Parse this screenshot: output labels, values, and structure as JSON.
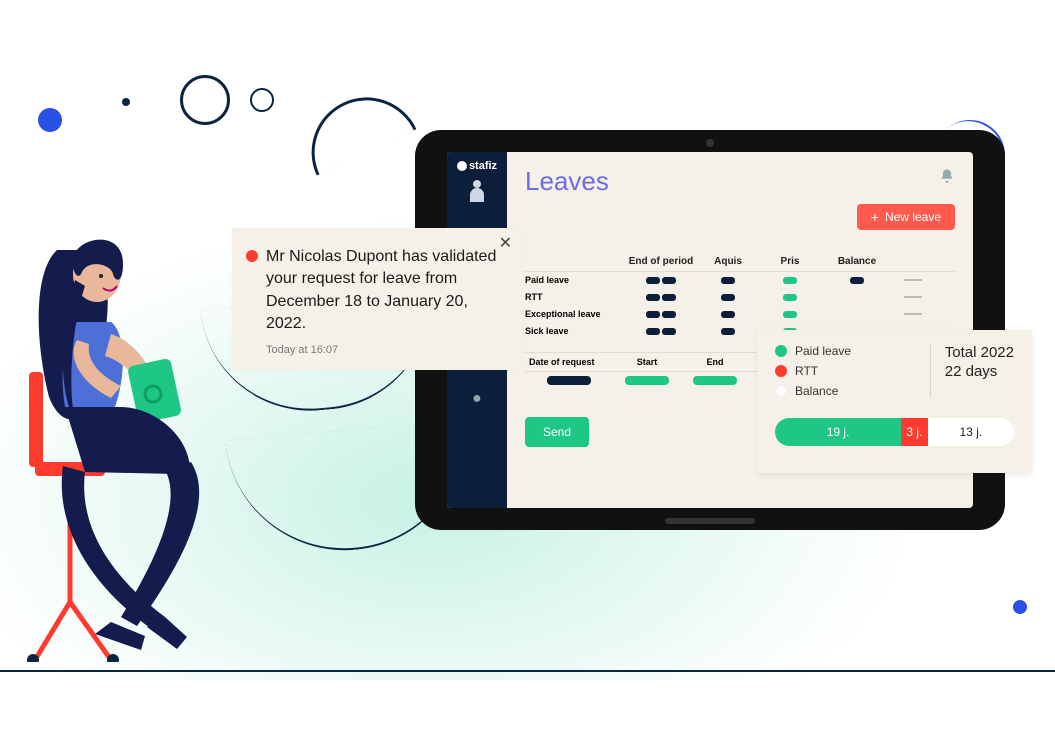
{
  "brand": "stafiz",
  "page_title": "Leaves",
  "new_leave_label": "New leave",
  "types_header": {
    "col1": "End of period",
    "col2": "Aquis",
    "col3": "Pris",
    "col4": "Balance"
  },
  "types_rows": [
    "Paid leave",
    "RTT",
    "Exceptional leave",
    "Sick leave"
  ],
  "requests_header": {
    "col0": "Date of request",
    "col1": "Start",
    "col2": "End"
  },
  "send_label": "Send",
  "notification": {
    "message": "Mr Nicolas Dupont has validated your request for leave from December 18 to January 20, 2022.",
    "time": "Today at 16:07"
  },
  "balance": {
    "legend": {
      "paid": "Paid leave",
      "rtt": "RTT",
      "solde": "Balance"
    },
    "total_label": "Total 2022",
    "total_days": "22 days",
    "segments": {
      "green": "19 j.",
      "red": "3 j.",
      "white": "13 j."
    }
  }
}
